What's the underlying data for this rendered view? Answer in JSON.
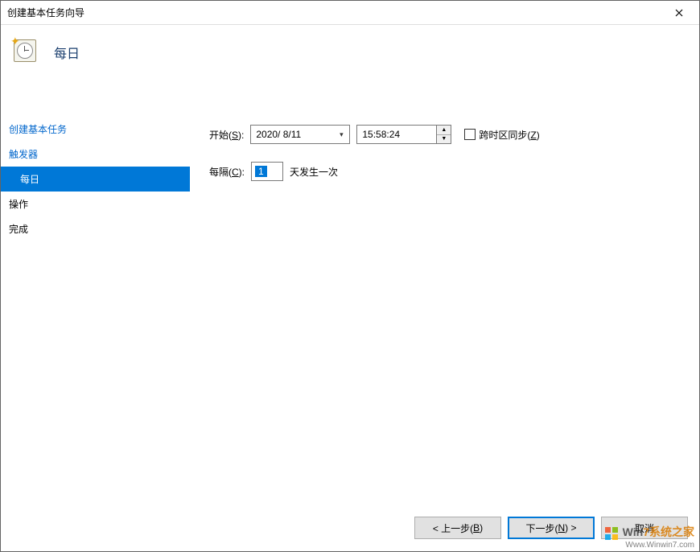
{
  "window": {
    "title": "创建基本任务向导"
  },
  "header": {
    "title": "每日"
  },
  "sidebar": {
    "items": [
      {
        "label": "创建基本任务",
        "indent": false,
        "selected": false
      },
      {
        "label": "触发器",
        "indent": false,
        "selected": false
      },
      {
        "label": "每日",
        "indent": true,
        "selected": true
      },
      {
        "label": "操作",
        "indent": false,
        "selected": false
      },
      {
        "label": "完成",
        "indent": false,
        "selected": false
      }
    ]
  },
  "content": {
    "start_label_pre": "开始(",
    "start_label_key": "S",
    "start_label_post": "):",
    "date_value": "2020/ 8/11",
    "time_value": "15:58:24",
    "sync_checkbox_label_pre": "跨时区同步(",
    "sync_checkbox_key": "Z",
    "sync_checkbox_label_post": ")",
    "sync_checked": false,
    "interval_label_pre": "每隔(",
    "interval_label_key": "C",
    "interval_label_post": "):",
    "interval_value": "1",
    "interval_unit": "天发生一次"
  },
  "footer": {
    "back_pre": "< 上一步(",
    "back_key": "B",
    "back_post": ")",
    "next_pre": "下一步(",
    "next_key": "N",
    "next_post": ") >",
    "cancel": "取消"
  },
  "watermark": {
    "brand_prefix": "Win",
    "brand_suffix": "7系统之家",
    "url": "Www.Winwin7.com"
  }
}
